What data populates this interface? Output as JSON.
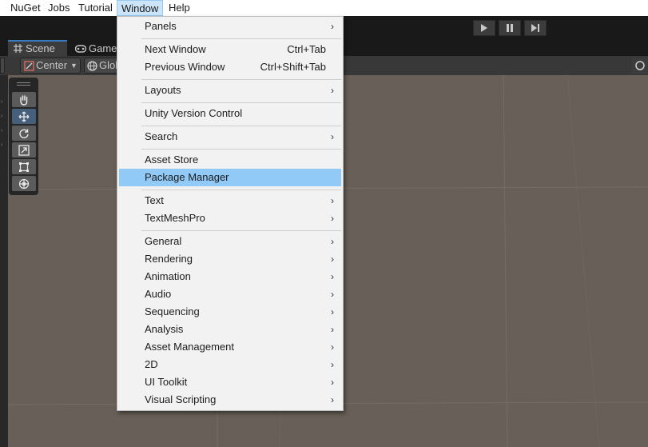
{
  "menubar": {
    "items": [
      "NuGet",
      "Jobs",
      "Tutorial",
      "Window",
      "Help"
    ]
  },
  "tabs": {
    "scene_label": "Scene",
    "game_label": "Game"
  },
  "toolbar": {
    "pivot_label": "Center",
    "space_label": "Glob"
  },
  "menu": {
    "panels": "Panels",
    "next_window": "Next Window",
    "next_window_shortcut": "Ctrl+Tab",
    "previous_window": "Previous Window",
    "previous_window_shortcut": "Ctrl+Shift+Tab",
    "layouts": "Layouts",
    "unity_version_control": "Unity Version Control",
    "search": "Search",
    "asset_store": "Asset Store",
    "package_manager": "Package Manager",
    "text": "Text",
    "textmeshpro": "TextMeshPro",
    "general": "General",
    "rendering": "Rendering",
    "animation": "Animation",
    "audio": "Audio",
    "sequencing": "Sequencing",
    "analysis": "Analysis",
    "asset_management": "Asset Management",
    "two_d": "2D",
    "ui_toolkit": "UI Toolkit",
    "visual_scripting": "Visual Scripting",
    "submenu_arrow": "›"
  },
  "colors": {
    "menu_highlight": "#91c9f7",
    "scene_background": "#686058",
    "active_tab_accent": "#3a79bb"
  },
  "icons": [
    "play-icon",
    "pause-icon",
    "step-icon",
    "scene-grid-icon",
    "gamepad-icon",
    "pivot-icon",
    "globe-icon",
    "hand-tool-icon",
    "move-tool-icon",
    "rotate-tool-icon",
    "scale-tool-icon",
    "rect-tool-icon",
    "transform-tool-icon"
  ]
}
